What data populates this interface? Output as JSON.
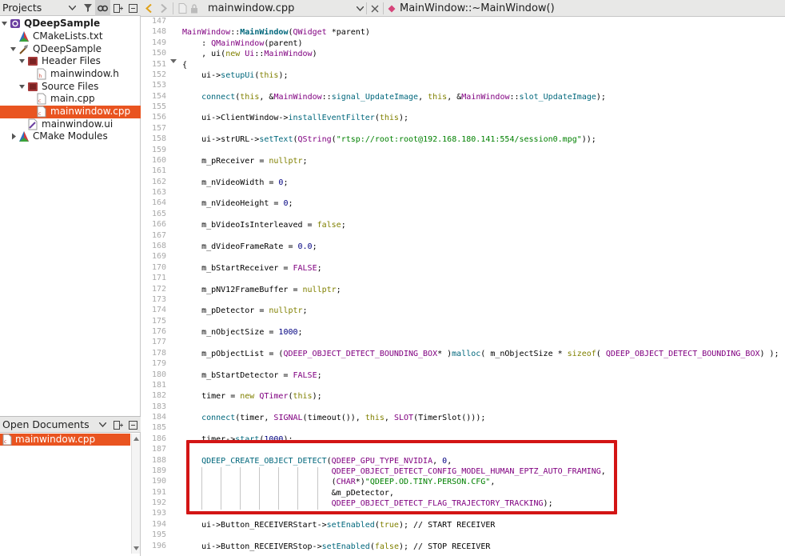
{
  "projects_pane": {
    "title": "Projects",
    "tree": [
      {
        "label": "QDeepSample",
        "icon": "qt-project-icon",
        "depth": 0,
        "expanded": true,
        "bold": true
      },
      {
        "label": "CMakeLists.txt",
        "icon": "cmake-file-icon",
        "depth": 1,
        "expanded": null,
        "bold": false
      },
      {
        "label": "QDeepSample",
        "icon": "build-target-icon",
        "depth": 1,
        "expanded": true,
        "bold": false
      },
      {
        "label": "Header Files",
        "icon": "folder-icon",
        "depth": 2,
        "expanded": true,
        "bold": false
      },
      {
        "label": "mainwindow.h",
        "icon": "header-file-icon",
        "depth": 3,
        "expanded": null,
        "bold": false
      },
      {
        "label": "Source Files",
        "icon": "folder-icon",
        "depth": 2,
        "expanded": true,
        "bold": false
      },
      {
        "label": "main.cpp",
        "icon": "cpp-file-icon",
        "depth": 3,
        "expanded": null,
        "bold": false
      },
      {
        "label": "mainwindow.cpp",
        "icon": "cpp-file-icon",
        "depth": 3,
        "expanded": null,
        "bold": false,
        "selected": true
      },
      {
        "label": "mainwindow.ui",
        "icon": "ui-file-icon",
        "depth": 2,
        "expanded": null,
        "bold": false
      },
      {
        "label": "CMake Modules",
        "icon": "cmake-modules-icon",
        "depth": 1,
        "expanded": false,
        "bold": false
      }
    ]
  },
  "open_documents": {
    "title": "Open Documents",
    "items": [
      {
        "label": "mainwindow.cpp",
        "selected": true
      }
    ]
  },
  "editor_toolbar": {
    "file_name": "mainwindow.cpp",
    "symbol": "MainWindow::~MainWindow()"
  },
  "editor": {
    "line_numbers": [
      "147",
      "148",
      "149",
      "150",
      "151",
      "152",
      "153",
      "154",
      "155",
      "156",
      "157",
      "158",
      "159",
      "160",
      "161",
      "162",
      "163",
      "164",
      "165",
      "166",
      "167",
      "168",
      "169",
      "170",
      "171",
      "172",
      "173",
      "174",
      "175",
      "176",
      "177",
      "178",
      "179",
      "180",
      "181",
      "182",
      "183",
      "184",
      "185",
      "186",
      "187",
      "188",
      "189",
      "190",
      "191",
      "192",
      "193",
      "194",
      "195",
      "196"
    ],
    "lines": [
      "",
      "MainWindow::MainWindow(QWidget *parent)",
      "    : QMainWindow(parent)",
      "    , ui(new Ui::MainWindow)",
      "{",
      "    ui->setupUi(this);",
      "",
      "    connect(this, &MainWindow::signal_UpdateImage, this, &MainWindow::slot_UpdateImage);",
      "",
      "    ui->ClientWindow->installEventFilter(this);",
      "",
      "    ui->strURL->setText(QString(\"rtsp://root:root@192.168.180.141:554/session0.mpg\"));",
      "",
      "    m_pReceiver = nullptr;",
      "",
      "    m_nVideoWidth = 0;",
      "",
      "    m_nVideoHeight = 0;",
      "",
      "    m_bVideoIsInterleaved = false;",
      "",
      "    m_dVideoFrameRate = 0.0;",
      "",
      "    m_bStartReceiver = FALSE;",
      "",
      "    m_pNV12FrameBuffer = nullptr;",
      "",
      "    m_pDetector = nullptr;",
      "",
      "    m_nObjectSize = 1000;",
      "",
      "    m_pObjectList = (QDEEP_OBJECT_DETECT_BOUNDING_BOX* )malloc( m_nObjectSize * sizeof( QDEEP_OBJECT_DETECT_BOUNDING_BOX) );",
      "",
      "    m_bStartDetector = FALSE;",
      "",
      "    timer = new QTimer(this);",
      "",
      "    connect(timer, SIGNAL(timeout()), this, SLOT(TimerSlot()));",
      "",
      "    timer->start(1000);",
      "",
      "    QDEEP_CREATE_OBJECT_DETECT(QDEEP_GPU_TYPE_NVIDIA, 0,",
      "                               QDEEP_OBJECT_DETECT_CONFIG_MODEL_HUMAN_EPTZ_AUTO_FRAMING,",
      "                               (CHAR*)\"QDEEP.OD.TINY.PERSON.CFG\",",
      "                               &m_pDetector,",
      "                               QDEEP_OBJECT_DETECT_FLAG_TRAJECTORY_TRACKING);",
      "",
      "    ui->Button_RECEIVERStart->setEnabled(true); // START RECEIVER",
      "",
      "    ui->Button_RECEIVERStop->setEnabled(false); // STOP RECEIVER"
    ]
  },
  "colors": {
    "selection": "#e95420",
    "highlight_box": "#d31515",
    "keyword": "#808000",
    "function": "#00677c",
    "type": "#800080",
    "string": "#008000",
    "number": "#000080"
  }
}
